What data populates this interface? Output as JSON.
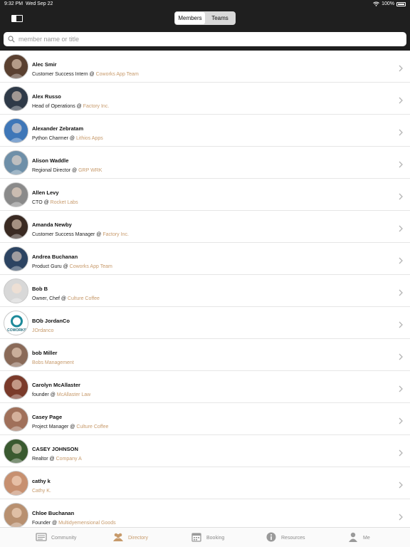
{
  "status_bar": {
    "time": "9:32 PM",
    "date": "Wed Sep 22",
    "battery": "100%"
  },
  "segments": [
    {
      "label": "Members",
      "active": true
    },
    {
      "label": "Teams",
      "active": false
    }
  ],
  "search": {
    "placeholder": "member name or title",
    "value": ""
  },
  "members": [
    {
      "name": "Alec Smir",
      "title": "Customer Success Intern",
      "company": "Coworks App Team",
      "avatar_color": "#5a4030"
    },
    {
      "name": "Alex Russo",
      "title": "Head of Operations",
      "company": "Factory Inc.",
      "avatar_color": "#2f3a48"
    },
    {
      "name": "Alexander Zebratam",
      "title": "Python Charmer",
      "company": "Lithios Apps",
      "avatar_color": "#3f77b8"
    },
    {
      "name": "Alison Waddle",
      "title": "Regional Director",
      "company": "GRP WRK",
      "avatar_color": "#6e8fa8"
    },
    {
      "name": "Allen Levy",
      "title": "CTO",
      "company": "Rocket Labs",
      "avatar_color": "#8a8a8a"
    },
    {
      "name": "Amanda Newby",
      "title": "Customer Success Manager",
      "company": "Factory Inc.",
      "avatar_color": "#3a2a22"
    },
    {
      "name": "Andrea Buchanan",
      "title": "Product Guru",
      "company": "Coworks App Team",
      "avatar_color": "#2c4462"
    },
    {
      "name": "Bob B",
      "title": "Owner, Chef",
      "company": "Culture Coffee",
      "avatar_color": "#d8d8d8"
    },
    {
      "name": "BOb JordanCo",
      "title": "",
      "company": "JOrdanco",
      "avatar_color": "#ffffff",
      "logo_text": "COWORKS"
    },
    {
      "name": "bob Miller",
      "title": "",
      "company": "Bobs Management",
      "avatar_color": "#8a6a58"
    },
    {
      "name": "Carolyn McAllaster",
      "title": "founder",
      "company": "McAllaster Law",
      "avatar_color": "#7a3a2a"
    },
    {
      "name": "Casey Page",
      "title": "Project Manager",
      "company": "Culture Coffee",
      "avatar_color": "#a0705a"
    },
    {
      "name": "CASEY JOHNSON",
      "title": "Realtor",
      "company": "Company A",
      "avatar_color": "#3a5a30"
    },
    {
      "name": "cathy k",
      "title": "",
      "company": "Cathy K.",
      "avatar_color": "#c79070"
    },
    {
      "name": "Chloe Buchanan",
      "title": "Founder",
      "company": "Multidyemensional Goods",
      "avatar_color": "#b89070"
    }
  ],
  "tabs": [
    {
      "label": "Community",
      "icon": "community-icon",
      "active": false
    },
    {
      "label": "Directory",
      "icon": "directory-icon",
      "active": true
    },
    {
      "label": "Booking",
      "icon": "calendar-icon",
      "active": false
    },
    {
      "label": "Resources",
      "icon": "info-icon",
      "active": false
    },
    {
      "label": "Me",
      "icon": "person-icon",
      "active": false
    }
  ],
  "colors": {
    "accent": "#c79a6b",
    "topbar": "#1f1f1f",
    "tab_inactive": "#8a8a8a"
  }
}
